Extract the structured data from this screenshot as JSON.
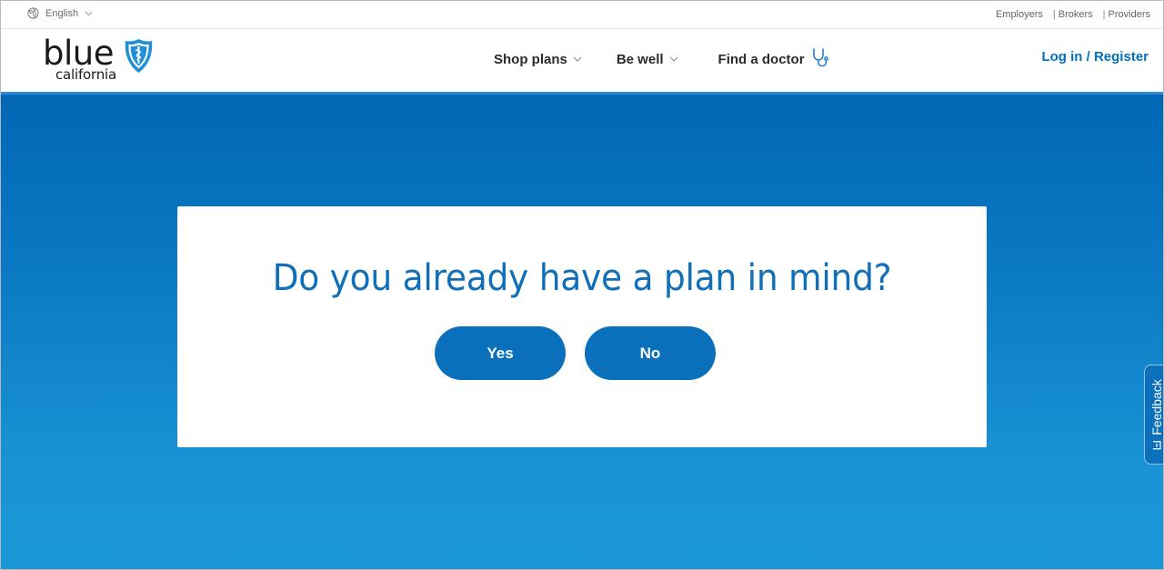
{
  "utility_bar": {
    "language": "English",
    "links": [
      {
        "label": "Employers"
      },
      {
        "label": "Brokers"
      },
      {
        "label": "Providers"
      }
    ]
  },
  "header": {
    "logo": {
      "line1": "blue",
      "line2": "california"
    },
    "nav": [
      {
        "label": "Shop plans",
        "icon": "chevron-down-icon"
      },
      {
        "label": "Be well",
        "icon": "chevron-down-icon"
      },
      {
        "label": "Find a doctor",
        "icon": "stethoscope-icon"
      }
    ],
    "login_label": "Log in / Register"
  },
  "dialog": {
    "question": "Do you already have a plan in mind?",
    "yes_label": "Yes",
    "no_label": "No"
  },
  "feedback": {
    "label": "Feedback"
  },
  "colors": {
    "brand_blue": "#0072bc",
    "hero_top": "#0067b5",
    "hero_bottom": "#1b96d6",
    "button": "#0b70bc"
  }
}
